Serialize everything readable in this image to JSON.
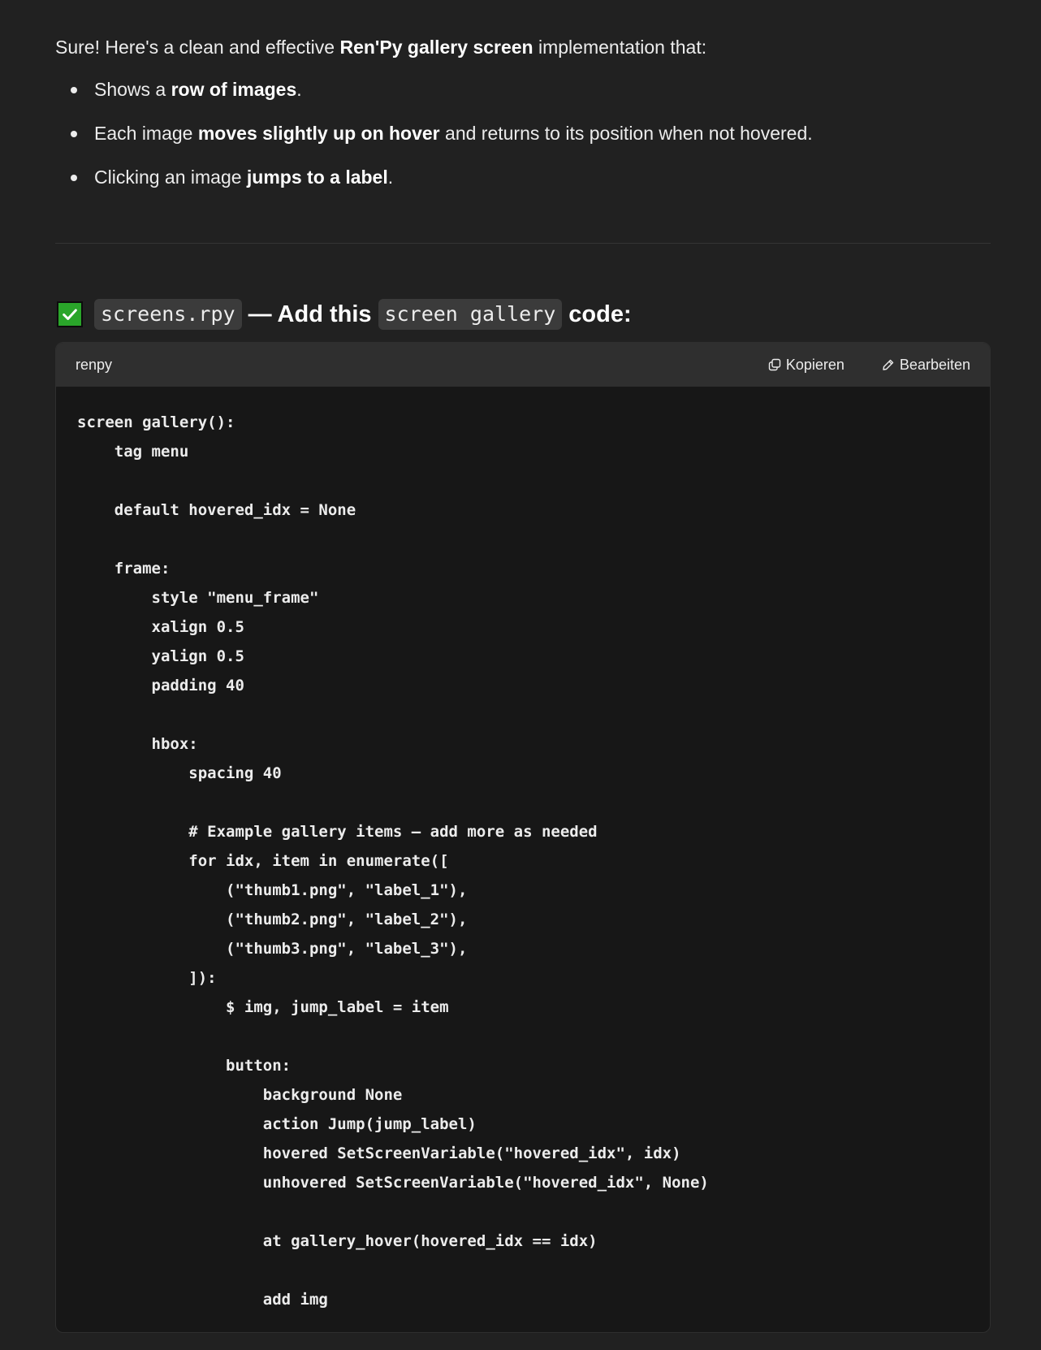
{
  "intro": {
    "prefix": "Sure! Here's a clean and effective ",
    "bold": "Ren'Py gallery screen",
    "suffix": " implementation that:"
  },
  "bullets": [
    {
      "pre": "Shows a ",
      "bold": "row of images",
      "post": "."
    },
    {
      "pre": "Each image ",
      "bold": "moves slightly up on hover",
      "post": " and returns to its position when not hovered."
    },
    {
      "pre": "Clicking an image ",
      "bold": "jumps to a label",
      "post": "."
    }
  ],
  "heading": {
    "icon": "checkmark-icon",
    "file_code": "screens.rpy",
    "middle": "— Add this",
    "screen_code": "screen gallery",
    "suffix": "code:"
  },
  "code_block": {
    "language": "renpy",
    "copy_label": "Kopieren",
    "edit_label": "Bearbeiten",
    "code": "screen gallery():\n    tag menu\n\n    default hovered_idx = None\n\n    frame:\n        style \"menu_frame\"\n        xalign 0.5\n        yalign 0.5\n        padding 40\n\n        hbox:\n            spacing 40\n\n            # Example gallery items — add more as needed\n            for idx, item in enumerate([\n                (\"thumb1.png\", \"label_1\"),\n                (\"thumb2.png\", \"label_2\"),\n                (\"thumb3.png\", \"label_3\"),\n            ]):\n                $ img, jump_label = item\n\n                button:\n                    background None\n                    action Jump(jump_label)\n                    hovered SetScreenVariable(\"hovered_idx\", idx)\n                    unhovered SetScreenVariable(\"hovered_idx\", None)\n\n                    at gallery_hover(hovered_idx == idx)\n\n                    add img"
  },
  "colors": {
    "background": "#212121",
    "code_background": "#171717",
    "code_header": "#2f2f2f",
    "check_green": "#2aa52a"
  }
}
